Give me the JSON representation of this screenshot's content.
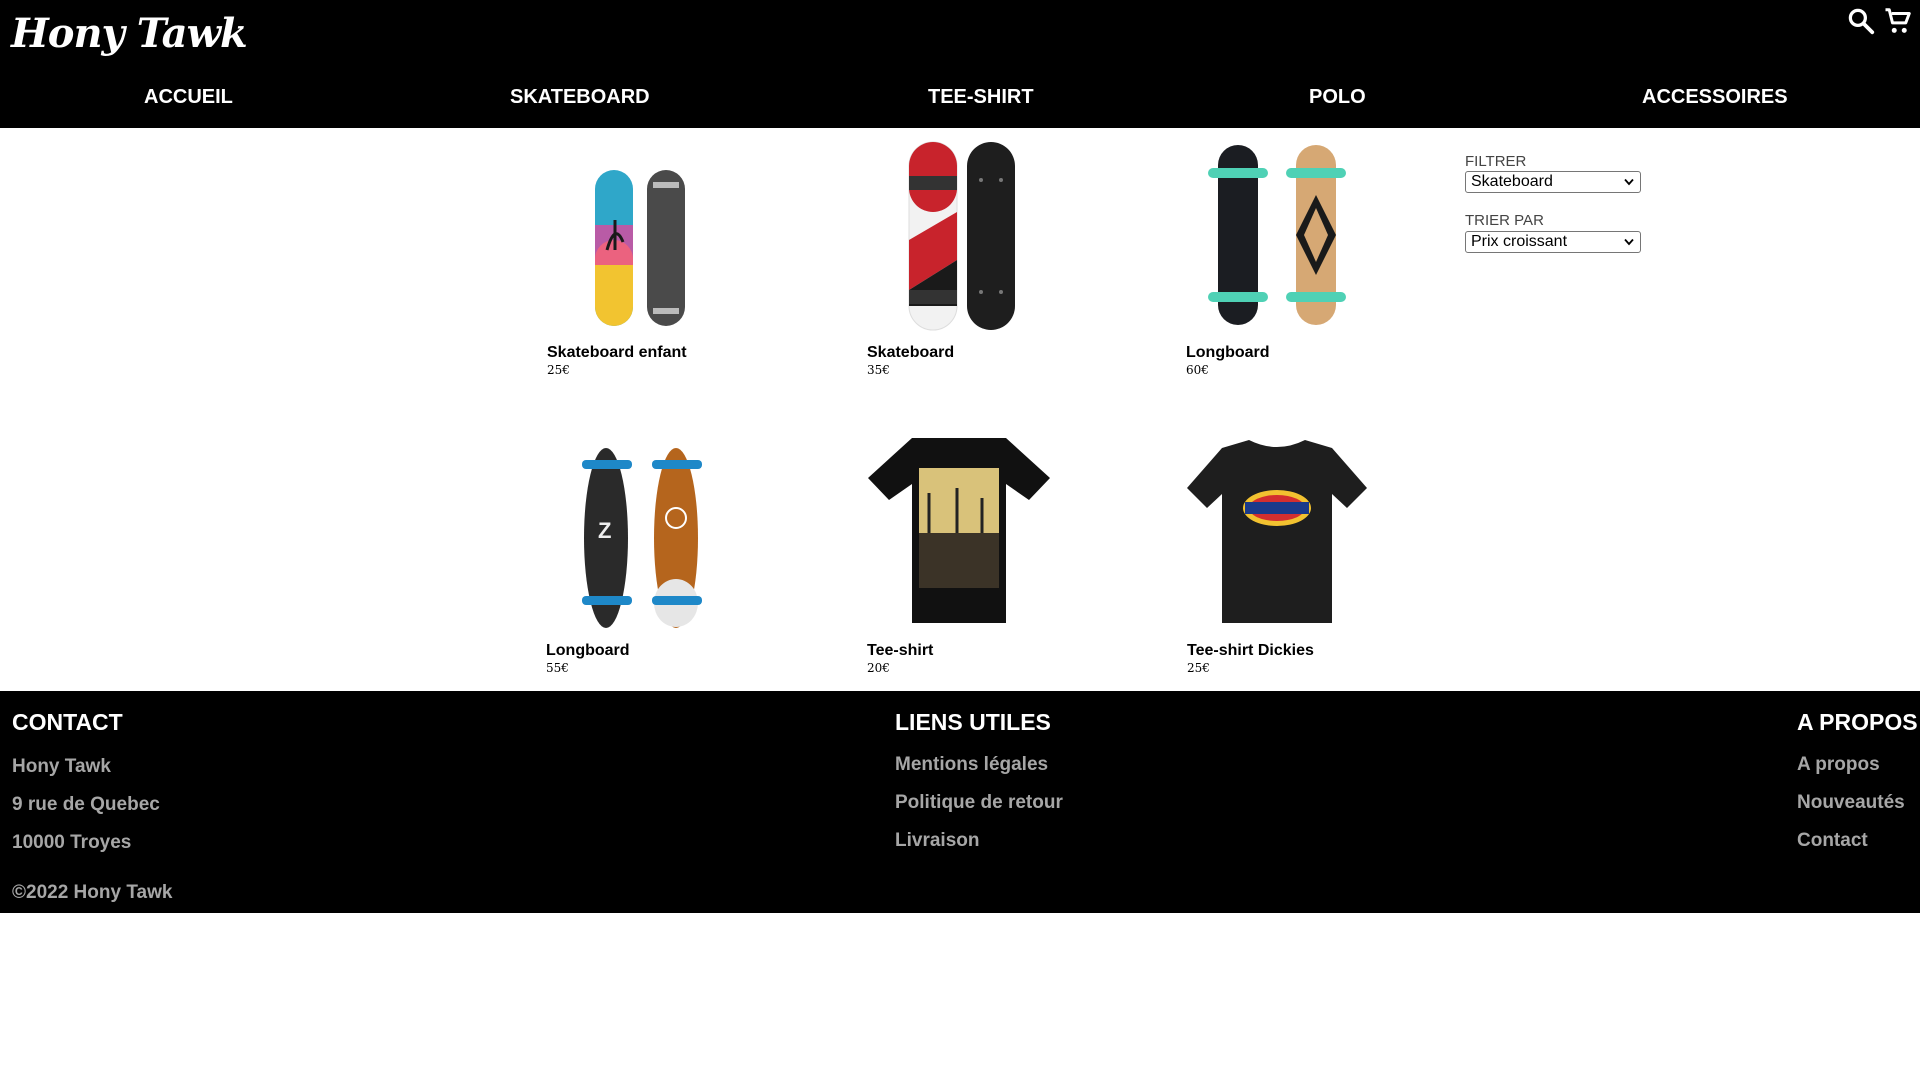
{
  "header": {
    "logo": "Hony Tawk",
    "icons": [
      "search-icon",
      "cart-icon"
    ],
    "nav": [
      "ACCUEIL",
      "SKATEBOARD",
      "TEE-SHIRT",
      "POLO",
      "ACCESSOIRES"
    ]
  },
  "products": [
    {
      "name": "Skateboard enfant",
      "price": "25€",
      "image": "skateboard-image"
    },
    {
      "name": "Skateboard",
      "price": "35€",
      "image": "skateboard-image"
    },
    {
      "name": "Longboard",
      "price": "60€",
      "image": "longboard-image"
    },
    {
      "name": "Longboard",
      "price": "55€",
      "image": "longboard-image"
    },
    {
      "name": "Tee-shirt",
      "price": "20€",
      "image": "tee-shirt-image"
    },
    {
      "name": "Tee-shirt Dickies",
      "price": "25€",
      "image": "tee-shirt-image"
    }
  ],
  "filter": {
    "filter_label": "FILTRER",
    "filter_value": "Skateboard",
    "sort_label": "TRIER PAR",
    "sort_value": "Prix croissant"
  },
  "footer": {
    "contact": {
      "title": "CONTACT",
      "lines": [
        "Hony Tawk",
        "9 rue de Quebec",
        "10000 Troyes"
      ]
    },
    "liens": {
      "title": "LIENS UTILES",
      "links": [
        "Mentions légales",
        "Politique de retour",
        "Livraison"
      ]
    },
    "apropos": {
      "title": "A PROPOS",
      "links": [
        "A propos",
        "Nouveautés",
        "Contact"
      ]
    },
    "copyright": "©2022 Hony Tawk"
  },
  "colors": {
    "header_bg": "#000000",
    "footer_bg": "#000000",
    "footer_link": "#a6a6a6"
  }
}
